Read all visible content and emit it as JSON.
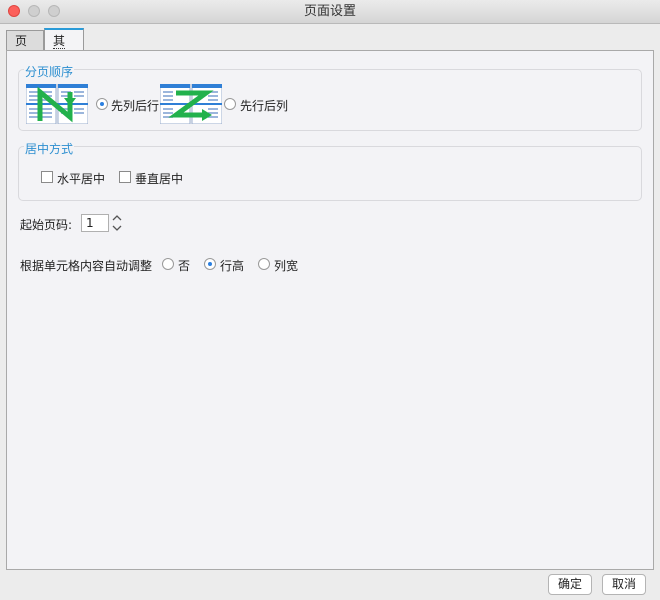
{
  "window": {
    "title": "页面设置"
  },
  "tabs": [
    {
      "label": "页面"
    },
    {
      "label": "其他"
    }
  ],
  "page_order": {
    "legend": "分页顺序",
    "options": [
      {
        "label": "先列后行",
        "selected": true,
        "icon": "column-first-order-icon"
      },
      {
        "label": "先行后列",
        "selected": false,
        "icon": "row-first-order-icon"
      }
    ]
  },
  "centering": {
    "legend": "居中方式",
    "options": [
      {
        "label": "水平居中",
        "checked": false
      },
      {
        "label": "垂直居中",
        "checked": false
      }
    ]
  },
  "start_page": {
    "label": "起始页码:",
    "value": "1"
  },
  "auto_adjust": {
    "label": "根据单元格内容自动调整",
    "options": [
      {
        "label": "否",
        "selected": false
      },
      {
        "label": "行高",
        "selected": true
      },
      {
        "label": "列宽",
        "selected": false
      }
    ]
  },
  "buttons": {
    "ok": "确定",
    "cancel": "取消"
  },
  "colors": {
    "accent": "#2d8fd0",
    "arrow": "#22b14c",
    "close": "#fc605b"
  }
}
